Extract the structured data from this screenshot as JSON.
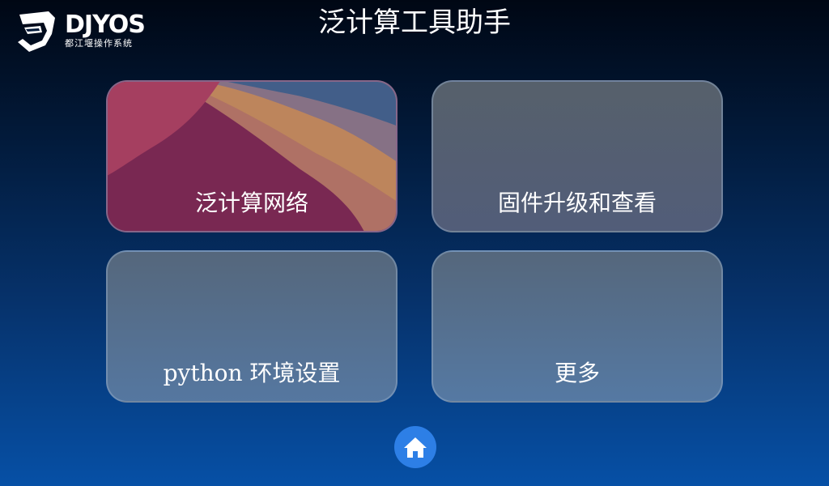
{
  "logo": {
    "wordmark": "DJYOS",
    "tagline": "都江堰操作系统"
  },
  "header": {
    "title": "泛计算工具助手"
  },
  "tiles": [
    {
      "label": "泛计算网络"
    },
    {
      "label": "固件升级和查看"
    },
    {
      "label": "python 环境设置"
    },
    {
      "label": "更多"
    }
  ],
  "nav": {
    "home_icon": "home-icon"
  },
  "colors": {
    "accent": "#2d7fe6",
    "background_top": "#000714",
    "background_bottom": "#0650a6"
  }
}
